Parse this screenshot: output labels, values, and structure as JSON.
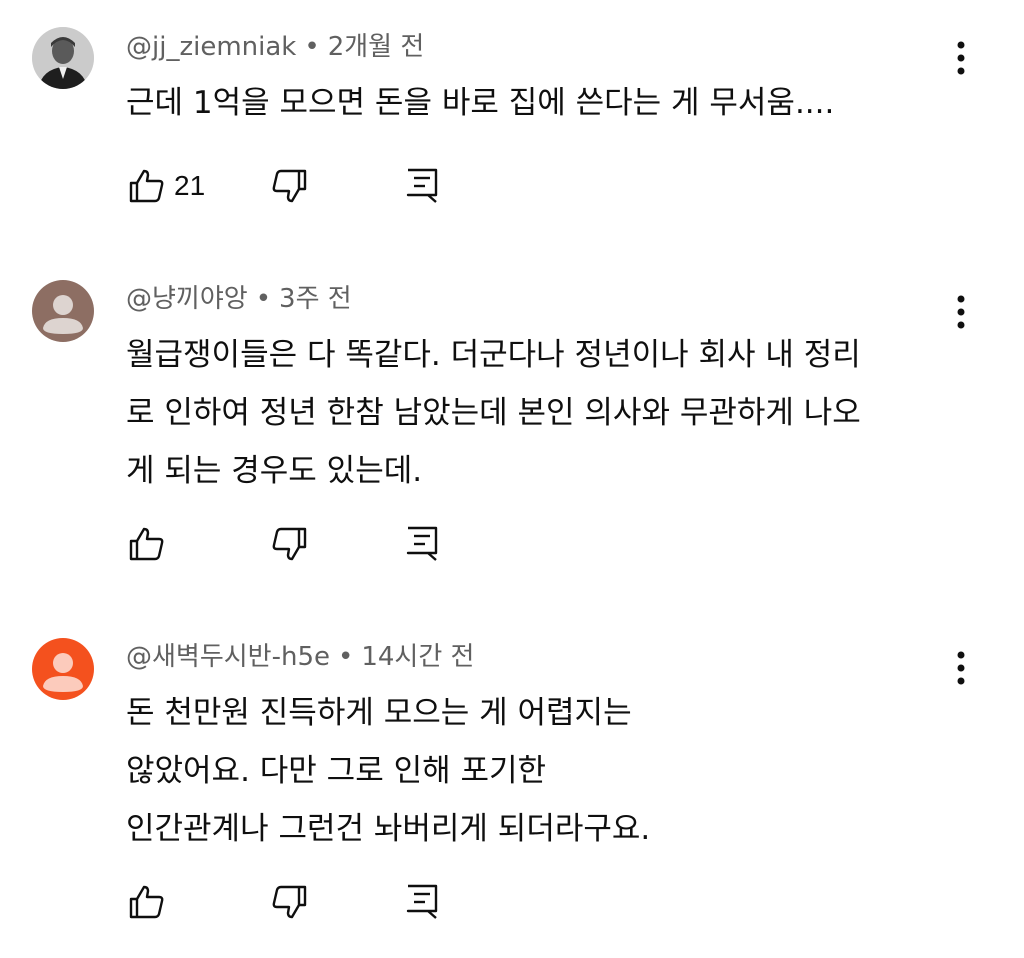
{
  "comments": [
    {
      "author": "@jj_ziemniak",
      "separator": "•",
      "time": "2개월 전",
      "text": "근데 1억을 모으면 돈을 바로 집에 쓴다는 게 무서움....",
      "likes": "21",
      "avatar": "photo-avatar"
    },
    {
      "author": "@냥끼야앙",
      "separator": "•",
      "time": "3주 전",
      "text": "월급쟁이들은 다 똑같다. 더군다나 정년이나 회사 내 정리\n로 인하여 정년 한참 남았는데 본인 의사와 무관하게 나오\n게 되는 경우도 있는데.",
      "likes": "",
      "avatar": "default-avatar",
      "avatar_color": "#8d6e63"
    },
    {
      "author": "@새벽두시반-h5e",
      "separator": "•",
      "time": "14시간 전",
      "text": "돈 천만원 진득하게 모으는 게 어렵지는\n않았어요. 다만 그로 인해 포기한\n인간관계나 그런건 놔버리게 되더라구요.",
      "likes": "",
      "avatar": "default-avatar",
      "avatar_color": "#f4511e"
    }
  ]
}
